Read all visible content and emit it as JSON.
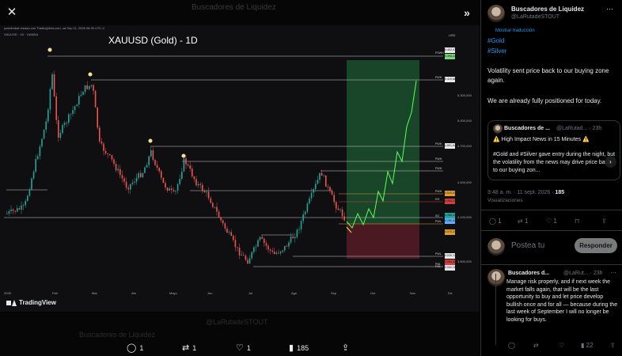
{
  "viewer": {
    "ghost_title": "Buscadores de Liquidez",
    "chart": {
      "meta": "yoshibobat creado con TradingView.com, sá Sep 11, 2026 08:39 UTC-4",
      "subtitle": "XAUUSD · 1D · OANDA",
      "title": "XAUUSD (Gold) - 1D",
      "currency": "USD",
      "months": [
        "2026",
        "Feb",
        "Mar",
        "Abr",
        "Mayo",
        "Jun",
        "Jul",
        "Ago",
        "Sep",
        "Oct",
        "Nov",
        "Dic"
      ],
      "right_ticks": [
        "5.300,000",
        "5.000,000",
        "4.700,000",
        "4.400,000",
        "4.100,000",
        "3.800,000"
      ],
      "price_tags": [
        "5.402,073",
        "5.398,221",
        "5.419,660",
        "4.891,943",
        "4.510,933",
        "4.454,232",
        "4.346,337",
        "4.285,421",
        "4.070,240",
        "4.030,131",
        "3.959,820",
        "3.942,100"
      ],
      "level_labels": [
        "PSWH",
        "PWH",
        "PWH",
        "PWH",
        "PWH",
        "PWH",
        "RG",
        "SG",
        "PWL",
        "PWL",
        "PML",
        "PML"
      ]
    },
    "brand": "TradingView",
    "actions": {
      "replies": "1",
      "reposts": "1",
      "likes": "1",
      "views": "185"
    },
    "faded_author": "Buscadores de Liquidez",
    "faded_handle": "@LaRutadeSTOUT"
  },
  "tweet": {
    "author_name": "Buscadores de Liquidez",
    "author_handle": "@LaRutadeSTOUT",
    "translate_label": "Mostrar traducción",
    "tags": [
      "#Gold",
      "#Silver"
    ],
    "paragraph_1": "Volatility sent price back to our buying zone again.",
    "paragraph_2": "We are already fully positioned for today.",
    "quote": {
      "author_name": "Buscadores de ...",
      "author_handle": "@LaRutad...",
      "time": "· 23h",
      "line_1": "⚠️ High Impact News in 15 Minutes ⚠️",
      "line_2": "#Gold and #Silver gave entry during the night, but the volatility from the news may drive price back to our buying zon..."
    },
    "timestamp": "3:48 a. m. · 11 sept. 2026 · ",
    "views_count": "185",
    "views_label": "Visualizaciones",
    "action_counts": {
      "replies": "1",
      "reposts": "1",
      "likes": "1"
    },
    "reply_placeholder": "Postea tu",
    "reply_button": "Responder"
  },
  "reply": {
    "author_name": "Buscadores d...",
    "author_handle": "@LaRut... · 23h",
    "text": "Manage risk properly, and if next week the market falls again, that will be the last opportunity to buy and let price develop bullish once and for all — because during the last week of September I will no longer be looking for buys.",
    "views": "22"
  }
}
